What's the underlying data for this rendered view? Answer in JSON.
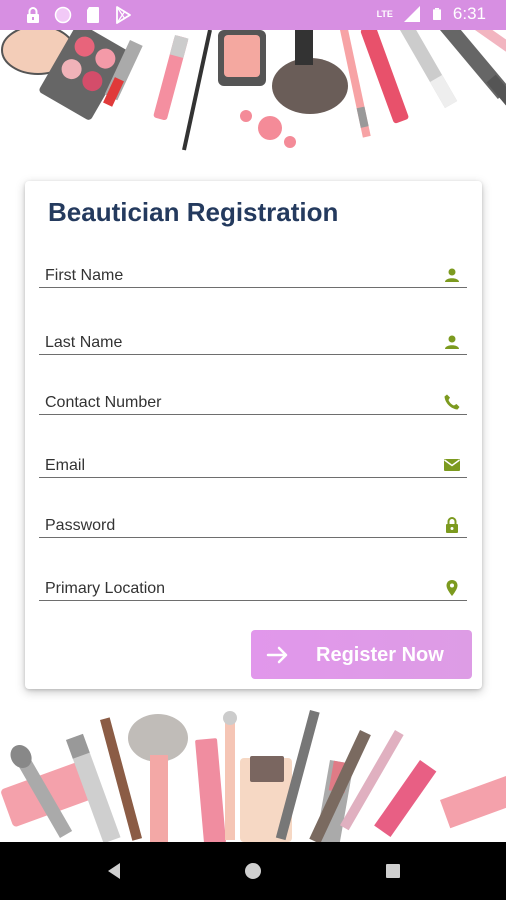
{
  "status_bar": {
    "time": "6:31",
    "network": "LTE",
    "bg_color": "#d78fe2",
    "icons": [
      "lock-icon",
      "circle-icon",
      "sd-card-icon",
      "play-store-icon",
      "signal-icon",
      "battery-icon"
    ]
  },
  "form": {
    "title": "Beautician Registration",
    "accent_color": "#7c9a1f",
    "fields": [
      {
        "label": "First Name",
        "icon": "person-icon"
      },
      {
        "label": "Last Name",
        "icon": "person-icon"
      },
      {
        "label": "Contact Number",
        "icon": "phone-icon"
      },
      {
        "label": "Email",
        "icon": "email-icon"
      },
      {
        "label": "Password",
        "icon": "lock-icon"
      },
      {
        "label": "Primary Location",
        "icon": "location-pin-icon"
      }
    ],
    "submit_label": "Register Now",
    "submit_icon": "arrow-right-icon"
  },
  "nav_bar": {
    "buttons": [
      "back-icon",
      "home-icon",
      "recents-icon"
    ]
  }
}
